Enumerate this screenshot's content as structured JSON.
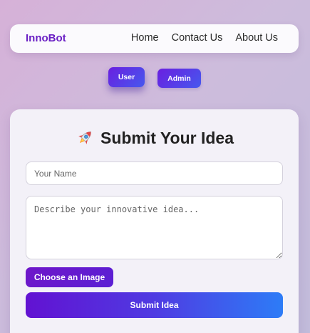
{
  "navbar": {
    "brand": "InnoBot",
    "links": [
      "Home",
      "Contact Us",
      "About Us"
    ]
  },
  "roles": {
    "user_label": "User",
    "admin_label": "Admin"
  },
  "form": {
    "title": "Submit Your Idea",
    "title_icon": "rocket-icon",
    "name_placeholder": "Your Name",
    "name_value": "",
    "idea_placeholder": "Describe your innovative idea...",
    "idea_value": "",
    "choose_image_label": "Choose an Image",
    "submit_label": "Submit Idea"
  },
  "colors": {
    "brand": "#6a1fc4",
    "accent_start": "#6212d2",
    "accent_end": "#2d7cf7"
  }
}
